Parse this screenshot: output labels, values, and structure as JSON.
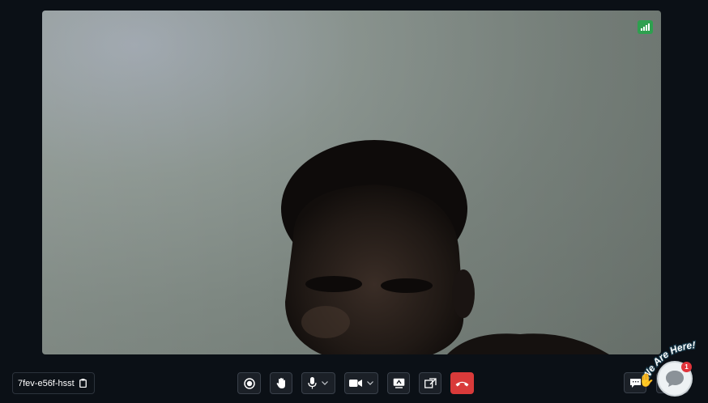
{
  "meeting": {
    "id": "7fev-e56f-hsst"
  },
  "toolbar": {
    "buttons": [
      {
        "name": "record",
        "icon": "record-icon"
      },
      {
        "name": "raise-hand",
        "icon": "hand-icon"
      },
      {
        "name": "microphone",
        "icon": "microphone-icon",
        "has_dropdown": true
      },
      {
        "name": "camera",
        "icon": "video-camera-icon",
        "has_dropdown": true
      },
      {
        "name": "screen-share",
        "icon": "screen-share-icon"
      },
      {
        "name": "switch-view",
        "icon": "switch-view-icon"
      },
      {
        "name": "end-call",
        "icon": "phone-hangup-icon"
      }
    ]
  },
  "chat_widget": {
    "banner_text": "We Are Here!",
    "unread_count": "1"
  },
  "colors": {
    "background": "#0b1016",
    "end_call": "#d93a3a",
    "signal": "#2ea04f",
    "badge": "#e0343b"
  }
}
